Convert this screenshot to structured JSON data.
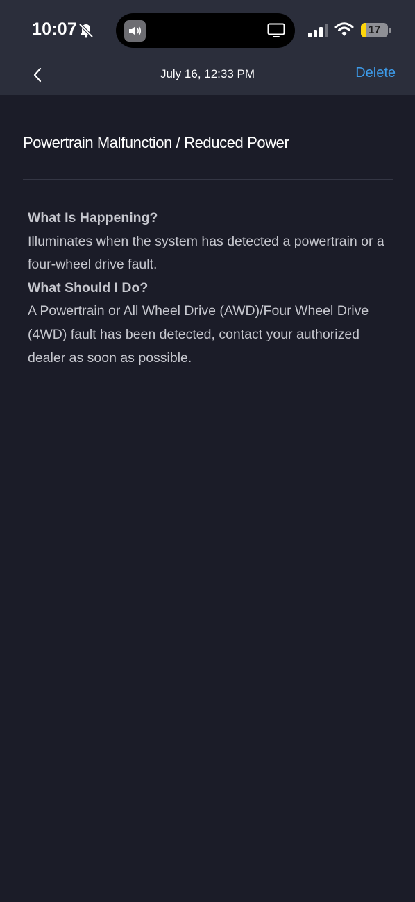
{
  "status_bar": {
    "time": "10:07",
    "battery_level": "17",
    "battery_fraction": 0.17,
    "icons": [
      "bell-slash-icon",
      "speaker-icon",
      "tv-icon",
      "signal-icon",
      "wifi-icon",
      "battery-icon"
    ]
  },
  "nav": {
    "back_icon": "chevron-left-icon",
    "title": "July 16, 12:33 PM",
    "delete_label": "Delete"
  },
  "alert": {
    "title": "Powertrain Malfunction / Reduced Power",
    "sections": [
      {
        "heading": "What Is Happening?",
        "text": "Illuminates when the system has detected a powertrain or a four-wheel drive fault."
      },
      {
        "heading": "What Should I Do?",
        "text": "A Powertrain or All Wheel Drive (AWD)/Four Wheel Drive (4WD) fault has been detected, contact your authorized dealer as soon as possible."
      }
    ]
  },
  "colors": {
    "background": "#1b1c28",
    "header": "#2b2e3b",
    "accent": "#3d9be9",
    "battery_low": "#ffd60a"
  }
}
